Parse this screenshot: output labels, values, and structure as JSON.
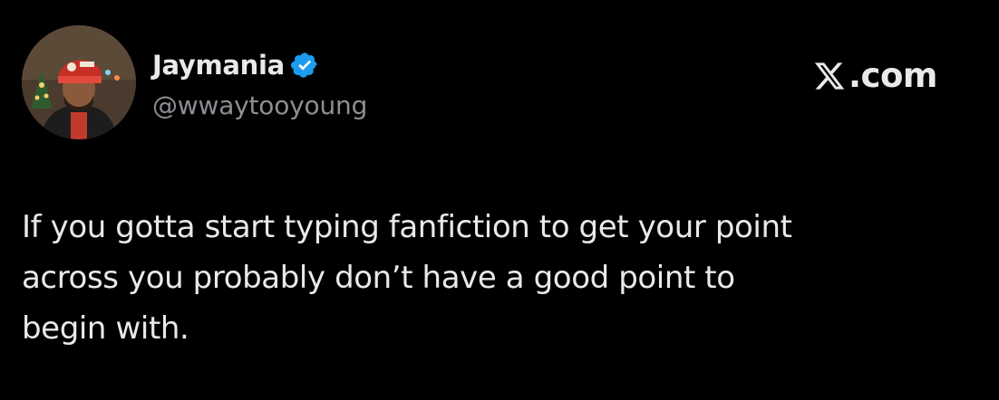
{
  "post": {
    "author": {
      "display_name": "Jaymania",
      "handle": "@wwaytooyoung",
      "verified": true,
      "verified_badge_color": "#1d9bf0",
      "avatar_icon": "profile-avatar"
    },
    "brand": {
      "icon": "x-logo-icon",
      "label": ".com"
    },
    "text_lines": [
      "If you gotta start typing fanfiction to get your point",
      "across you probably don’t have a good point to",
      "begin with."
    ]
  },
  "colors": {
    "background": "#000000",
    "primary_text": "#e7e9ea",
    "secondary_text": "#8b8f93",
    "accent": "#1d9bf0"
  }
}
